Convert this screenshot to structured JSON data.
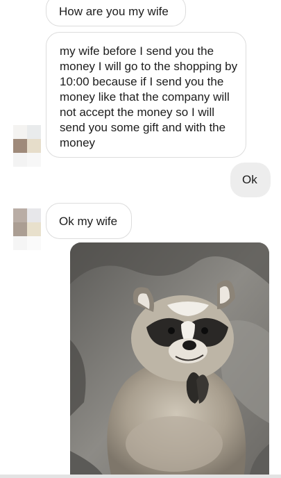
{
  "messages": [
    {
      "direction": "incoming",
      "text": "How are you my wife"
    },
    {
      "direction": "incoming",
      "text": "my wife before I send you the money I will go to the shopping by 10:00 because if I send you the money like that the company will not accept the money so I will send you some gift and with the money"
    },
    {
      "direction": "outgoing",
      "text": "Ok"
    },
    {
      "direction": "incoming",
      "text": "Ok my wife"
    }
  ],
  "image_message": {
    "subject": "raccoon photo"
  },
  "colors": {
    "incoming_bubble_border": "#dcdcdc",
    "outgoing_bubble_bg": "#ededed",
    "text": "#1c1c1c",
    "background": "#ffffff"
  }
}
